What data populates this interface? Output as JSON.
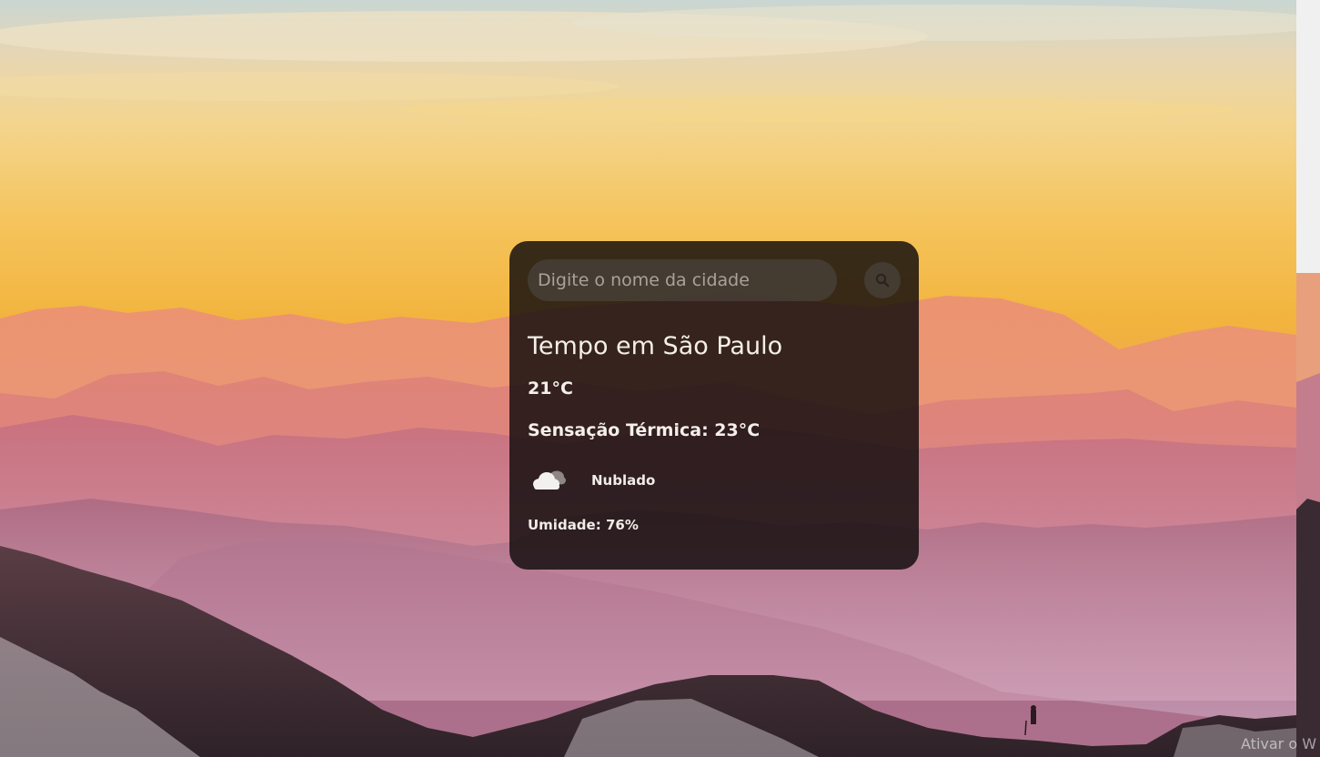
{
  "search": {
    "placeholder": "Digite o nome da cidade",
    "value": "",
    "button_icon": "search-icon"
  },
  "weather": {
    "title": "Tempo em São Paulo",
    "temperature": "21°C",
    "feels_like": "Sensação Térmica: 23°C",
    "condition": "Nublado",
    "condition_icon": "cloud-icon",
    "humidity": "Umidade: 76%"
  },
  "overlay": {
    "activation_text": "Ativar o W"
  },
  "colors": {
    "sky_top": "#d9ded7",
    "sky_glow": "#f2b840",
    "mountains_far": "#e8907a",
    "mountains_mid": "#b96f86",
    "foreground_rock": "#3a2b33",
    "card_background": "#110c0c",
    "card_text": "#f4efe9"
  }
}
